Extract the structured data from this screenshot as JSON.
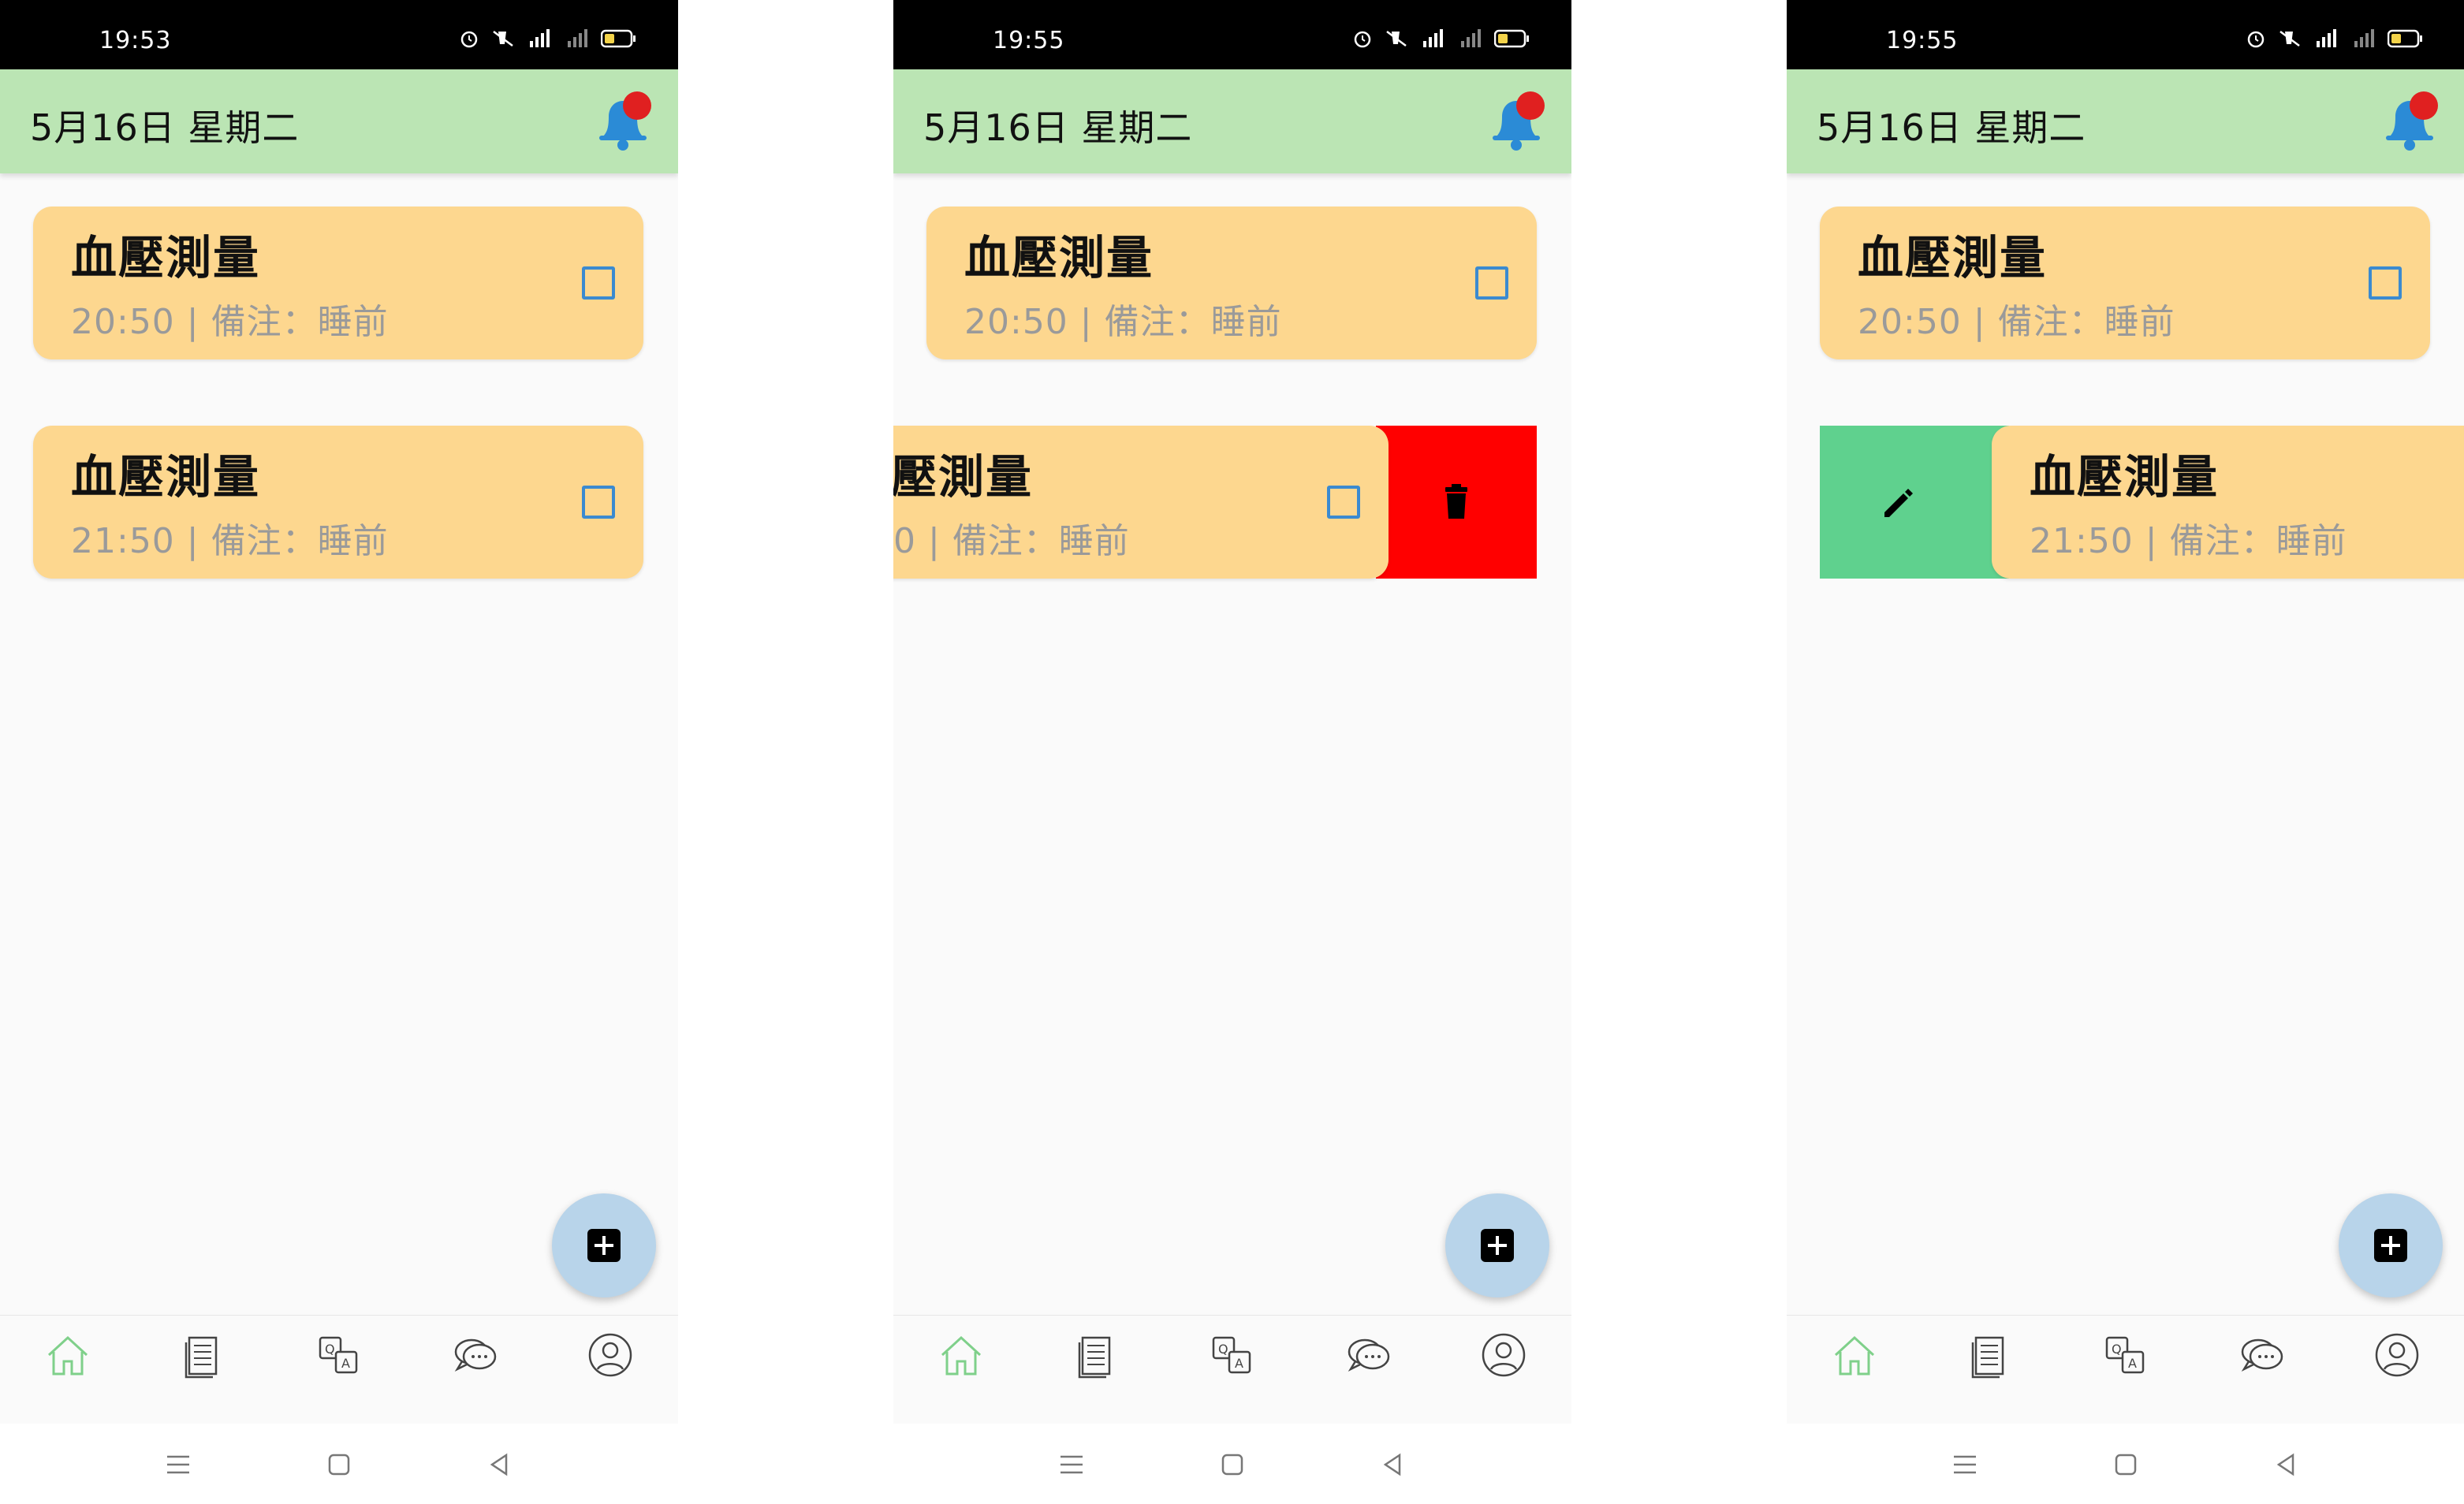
{
  "screens": [
    {
      "status_time": "19:53",
      "date": "5月16日 星期二",
      "cards": [
        {
          "title": "血壓測量",
          "subtitle": "20:50 | 備注：睡前"
        },
        {
          "title": "血壓測量",
          "subtitle": "21:50 | 備注：睡前"
        }
      ],
      "swipe_action": "none"
    },
    {
      "status_time": "19:55",
      "date": "5月16日 星期二",
      "cards": [
        {
          "title": "血壓測量",
          "subtitle": "20:50 | 備注：睡前"
        },
        {
          "title": "壓測量",
          "subtitle": "0 | 備注：睡前"
        }
      ],
      "swipe_action": "delete"
    },
    {
      "status_time": "19:55",
      "date": "5月16日 星期二",
      "cards": [
        {
          "title": "血壓測量",
          "subtitle": "20:50 | 備注：睡前"
        },
        {
          "title": "血壓測量",
          "subtitle": "21:50 | 備注：睡前"
        }
      ],
      "swipe_action": "edit"
    }
  ],
  "icons": {
    "notification": "bell-icon",
    "delete": "trash-icon",
    "edit": "pencil-icon",
    "add": "add-box-icon",
    "nav": [
      "home-icon",
      "document-icon",
      "translate-icon",
      "chat-icon",
      "profile-icon"
    ],
    "system_nav": [
      "menu-icon",
      "home-square-icon",
      "back-triangle-icon"
    ]
  },
  "colors": {
    "app_bar": "#bbe5b4",
    "card": "#fdd78f",
    "checkbox": "#3b8ad0",
    "delete_action": "#ff0000",
    "edit_action": "#5fd18e",
    "fab": "#b8d4ea",
    "active_nav": "#7fd08a",
    "bell": "#2b8bd6",
    "badge": "#e02020"
  }
}
